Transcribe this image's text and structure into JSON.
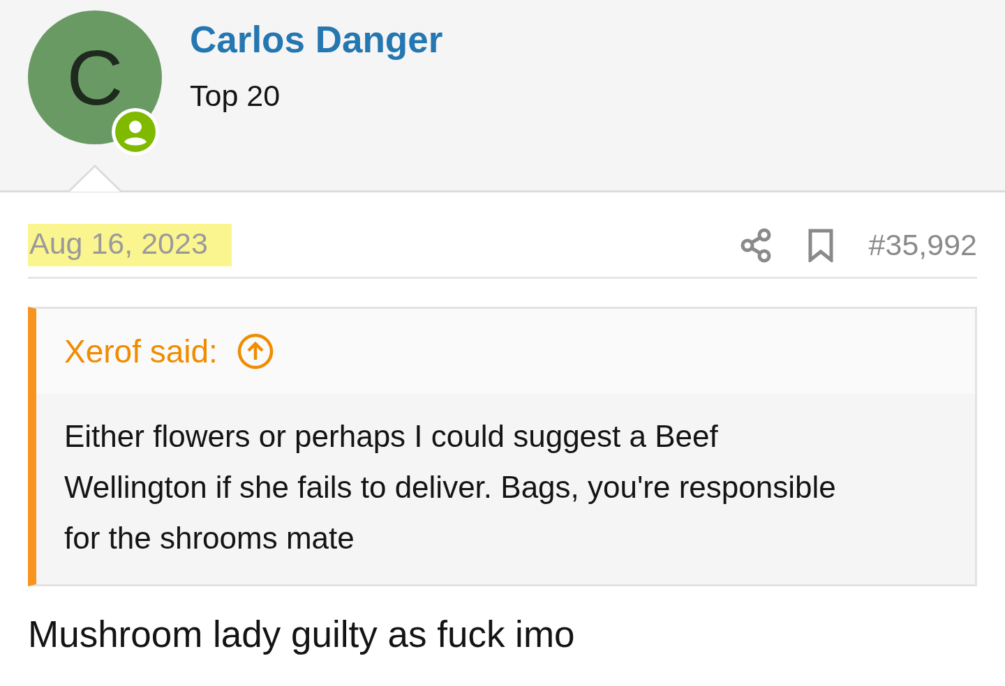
{
  "author": {
    "initial": "C",
    "name": "Carlos Danger",
    "rank": "Top 20",
    "online": true
  },
  "post": {
    "date": "Aug 16, 2023",
    "date_highlighted": true,
    "number": "#35,992",
    "quote": {
      "author": "Xerof said:",
      "text": "Either flowers or perhaps I could suggest a Beef Wellington if she fails to deliver. Bags, you're responsible for the shrooms mate"
    },
    "body": "Mushroom lady guilty as fuck imo"
  }
}
